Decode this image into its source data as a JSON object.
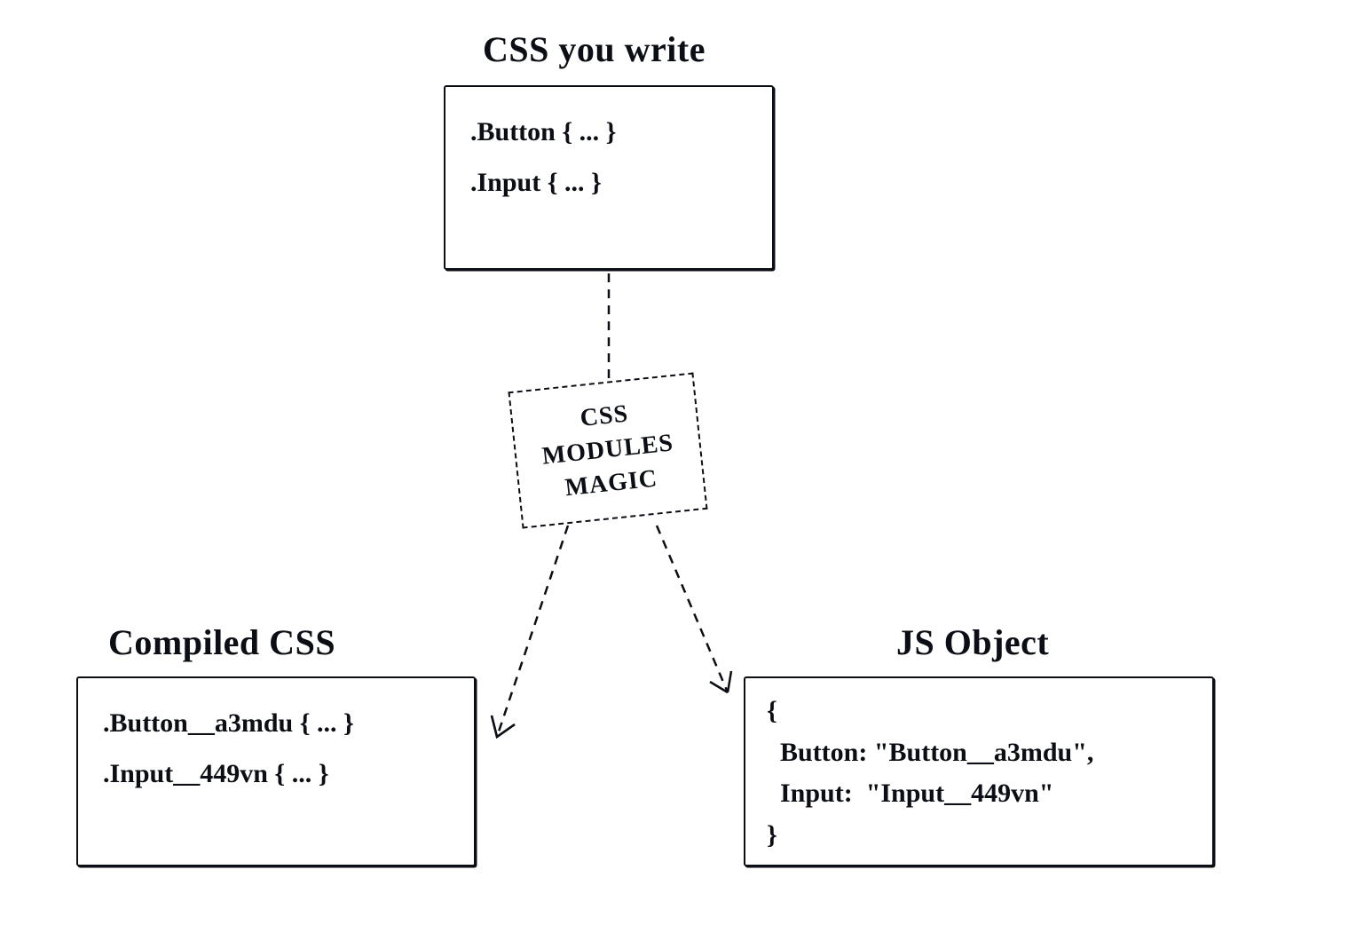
{
  "diagram": {
    "top": {
      "title": "CSS you write",
      "lines": [
        ".Button { ... }",
        ".Input { ... }"
      ]
    },
    "magic": {
      "lines": [
        "CSS",
        "MODULES",
        "MAGIC"
      ]
    },
    "left": {
      "title": "Compiled CSS",
      "lines": [
        ".Button__a3mdu { ... }",
        ".Input__449vn { ... }"
      ]
    },
    "right": {
      "title": "JS Object",
      "lines": [
        "{",
        "  Button: \"Button__a3mdu\",",
        "  Input:  \"Input__449vn\"",
        "}"
      ]
    }
  }
}
